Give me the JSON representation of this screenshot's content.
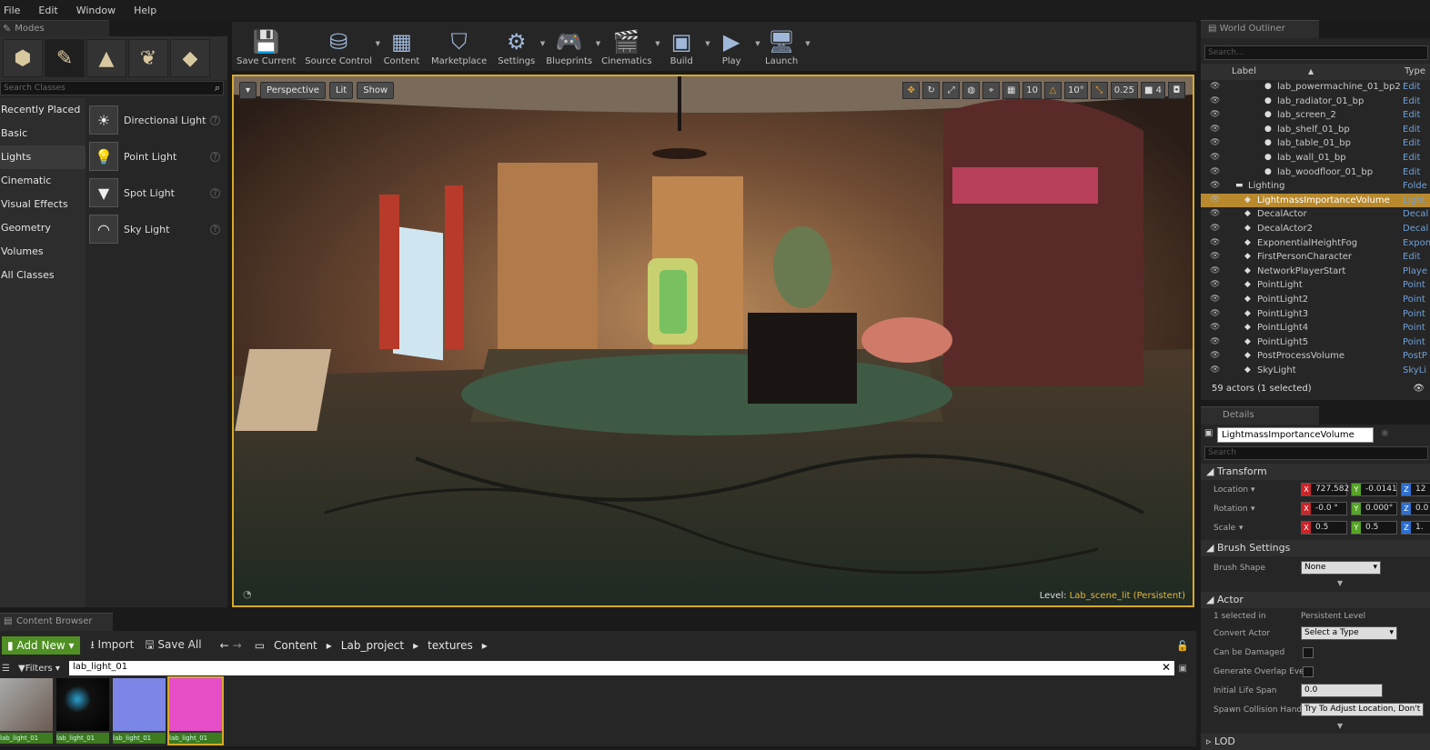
{
  "menu": [
    "File",
    "Edit",
    "Window",
    "Help"
  ],
  "modes": {
    "tab": "Modes",
    "search_placeholder": "Search Classes",
    "categories": [
      "Recently Placed",
      "Basic",
      "Lights",
      "Cinematic",
      "Visual Effects",
      "Geometry",
      "Volumes",
      "All Classes"
    ],
    "selected_category": "Lights",
    "lights": [
      "Directional Light",
      "Point Light",
      "Spot Light",
      "Sky Light"
    ]
  },
  "toolbar": [
    {
      "label": "Save Current",
      "icon": "save-icon"
    },
    {
      "label": "Source Control",
      "icon": "source-control-icon"
    },
    {
      "label": "Content",
      "icon": "content-icon"
    },
    {
      "label": "Marketplace",
      "icon": "marketplace-icon"
    },
    {
      "label": "Settings",
      "icon": "settings-icon"
    },
    {
      "label": "Blueprints",
      "icon": "blueprints-icon"
    },
    {
      "label": "Cinematics",
      "icon": "cinematics-icon"
    },
    {
      "label": "Build",
      "icon": "build-icon"
    },
    {
      "label": "Play",
      "icon": "play-icon"
    },
    {
      "label": "Launch",
      "icon": "launch-icon"
    }
  ],
  "viewport": {
    "perspective": "Perspective",
    "lit": "Lit",
    "show": "Show",
    "snap_grid": "10",
    "snap_angle": "10°",
    "snap_scale": "0.25",
    "camera_speed": "4",
    "level_label": "Level:",
    "level_name": "Lab_scene_lit (Persistent)"
  },
  "outliner": {
    "tab": "World Outliner",
    "search_placeholder": "Search...",
    "col_label": "Label",
    "col_type": "Type",
    "rows": [
      {
        "name": "lab_powermachine_01_bp2",
        "type": "Edit",
        "indent": 2
      },
      {
        "name": "lab_radiator_01_bp",
        "type": "Edit",
        "indent": 2
      },
      {
        "name": "lab_screen_2",
        "type": "Edit",
        "indent": 2
      },
      {
        "name": "lab_shelf_01_bp",
        "type": "Edit",
        "indent": 2
      },
      {
        "name": "lab_table_01_bp",
        "type": "Edit",
        "indent": 2
      },
      {
        "name": "lab_wall_01_bp",
        "type": "Edit",
        "indent": 2
      },
      {
        "name": "lab_woodfloor_01_bp",
        "type": "Edit",
        "indent": 2
      },
      {
        "name": "Lighting",
        "type": "Folde",
        "indent": 0
      },
      {
        "name": "LightmassImportanceVolume",
        "type": "Light",
        "indent": 1,
        "selected": true
      },
      {
        "name": "DecalActor",
        "type": "Decal",
        "indent": 1
      },
      {
        "name": "DecalActor2",
        "type": "Decal",
        "indent": 1
      },
      {
        "name": "ExponentialHeightFog",
        "type": "Expon",
        "indent": 1
      },
      {
        "name": "FirstPersonCharacter",
        "type": "Edit",
        "indent": 1
      },
      {
        "name": "NetworkPlayerStart",
        "type": "Playe",
        "indent": 1
      },
      {
        "name": "PointLight",
        "type": "Point",
        "indent": 1
      },
      {
        "name": "PointLight2",
        "type": "Point",
        "indent": 1
      },
      {
        "name": "PointLight3",
        "type": "Point",
        "indent": 1
      },
      {
        "name": "PointLight4",
        "type": "Point",
        "indent": 1
      },
      {
        "name": "PointLight5",
        "type": "Point",
        "indent": 1
      },
      {
        "name": "PostProcessVolume",
        "type": "PostP",
        "indent": 1
      },
      {
        "name": "SkyLight",
        "type": "SkyLi",
        "indent": 1
      }
    ],
    "footer": "59 actors (1 selected)"
  },
  "details": {
    "tab": "Details",
    "actor_name": "LightmassImportanceVolume",
    "search_placeholder": "Search",
    "transform": {
      "header": "Transform",
      "location_label": "Location",
      "location": [
        "727.582",
        "-0.0141",
        "12"
      ],
      "rotation_label": "Rotation",
      "rotation": [
        "-0.0 °",
        "0.000°",
        "0.0"
      ],
      "scale_label": "Scale",
      "scale": [
        "0.5",
        "0.5",
        "1."
      ]
    },
    "brush": {
      "header": "Brush Settings",
      "shape_label": "Brush Shape",
      "shape_value": "None"
    },
    "actor": {
      "header": "Actor",
      "selected_in_label": "1 selected in",
      "selected_in_value": "Persistent Level",
      "convert_label": "Convert Actor",
      "convert_value": "Select a Type",
      "damaged_label": "Can be Damaged",
      "overlap_label": "Generate Overlap Eve",
      "lifespan_label": "Initial Life Span",
      "lifespan_value": "0.0",
      "spawn_label": "Spawn Collision Hand",
      "spawn_value": "Try To Adjust Location, Don't"
    },
    "lod_header": "LOD"
  },
  "content_browser": {
    "tab": "Content Browser",
    "add_new": "Add New",
    "import": "Import",
    "save_all": "Save All",
    "path": [
      "Content",
      "Lab_project",
      "textures"
    ],
    "filters": "Filters",
    "search_value": "lab_light_01",
    "thumbs": [
      "lab_light_01",
      "lab_light_01",
      "lab_light_01",
      "lab_light_01"
    ]
  }
}
